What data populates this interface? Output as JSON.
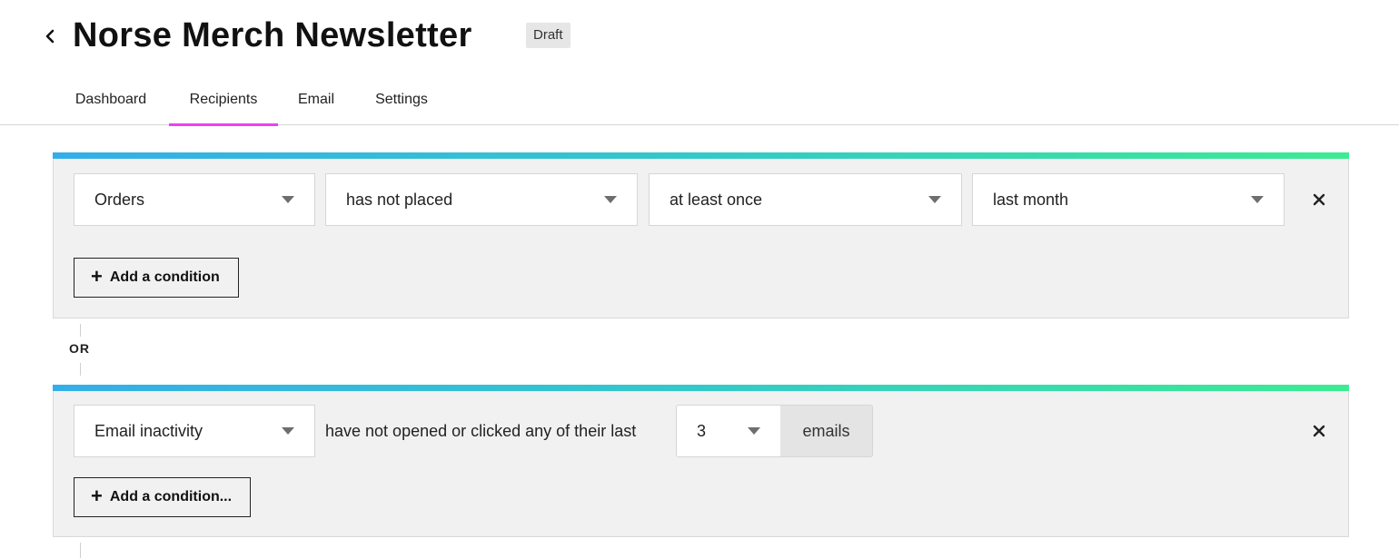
{
  "header": {
    "back_icon": "chevron-left-icon",
    "title": "Norse Merch Newsletter",
    "status": "Draft"
  },
  "tabs": [
    {
      "label": "Dashboard",
      "active": false
    },
    {
      "label": "Recipients",
      "active": true
    },
    {
      "label": "Email",
      "active": false
    },
    {
      "label": "Settings",
      "active": false
    }
  ],
  "colors": {
    "accent_tab": "#f03ef0",
    "gradient_start": "#34aee8",
    "gradient_mid": "#33c9c9",
    "gradient_end": "#3ceb92",
    "group_background": "#f1f1f1"
  },
  "groups": [
    {
      "conditions": [
        {
          "fields": [
            {
              "value": "Orders"
            },
            {
              "value": "has not placed"
            },
            {
              "value": "at least once"
            },
            {
              "value": "last month"
            }
          ],
          "remove_icon": "close-icon"
        }
      ],
      "add_label": "Add a condition",
      "add_icon": "plus-icon"
    },
    {
      "conditions": [
        {
          "fields": [
            {
              "value": "Email inactivity"
            }
          ],
          "text": "have not opened or clicked any of their last",
          "count": "3",
          "unit": "emails",
          "remove_icon": "close-icon"
        }
      ],
      "add_label": "Add a condition...",
      "add_icon": "plus-icon"
    }
  ],
  "connector_label": "OR"
}
